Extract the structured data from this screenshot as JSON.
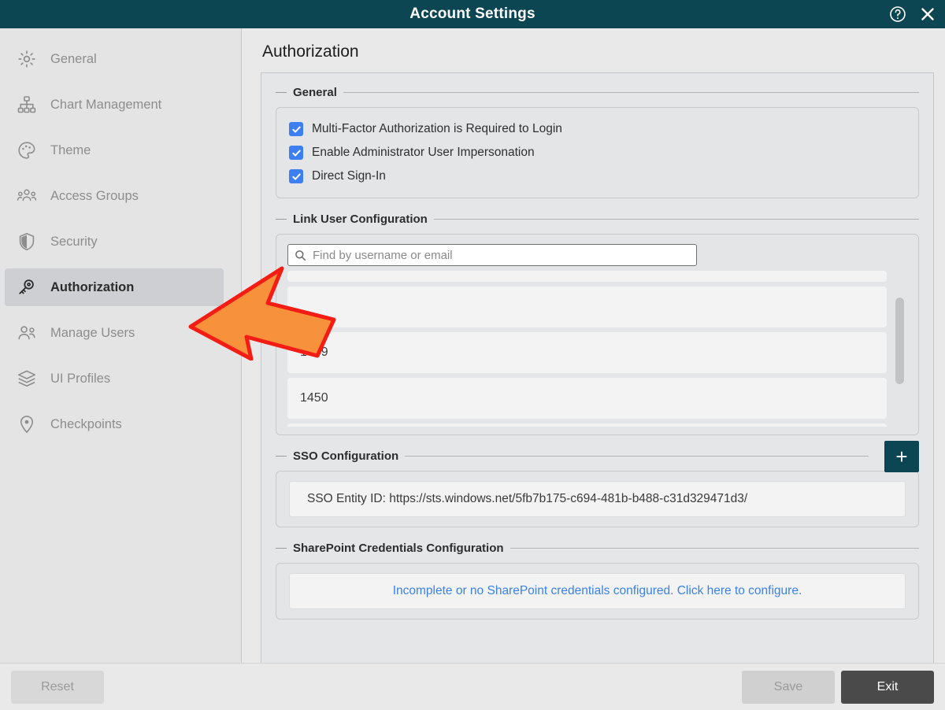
{
  "titlebar": {
    "title": "Account Settings",
    "help_icon": "help-circle-icon",
    "close_icon": "close-icon"
  },
  "sidebar": {
    "items": [
      {
        "label": "General",
        "icon": "gear-icon",
        "active": false
      },
      {
        "label": "Chart Management",
        "icon": "org-chart-icon",
        "active": false
      },
      {
        "label": "Theme",
        "icon": "palette-icon",
        "active": false
      },
      {
        "label": "Access Groups",
        "icon": "user-group-icon",
        "active": false
      },
      {
        "label": "Security",
        "icon": "shield-icon",
        "active": false
      },
      {
        "label": "Authorization",
        "icon": "key-icon",
        "active": true
      },
      {
        "label": "Manage Users",
        "icon": "users-icon",
        "active": false
      },
      {
        "label": "UI Profiles",
        "icon": "layers-icon",
        "active": false
      },
      {
        "label": "Checkpoints",
        "icon": "map-pin-icon",
        "active": false
      }
    ]
  },
  "main": {
    "page_title": "Authorization",
    "groups": {
      "general": {
        "title": "General",
        "checkboxes": [
          {
            "label": "Multi-Factor Authorization is Required to Login",
            "checked": true
          },
          {
            "label": "Enable Administrator User Impersonation",
            "checked": true
          },
          {
            "label": "Direct Sign-In",
            "checked": true
          }
        ]
      },
      "link_user": {
        "title": "Link User Configuration",
        "search_placeholder": "Find by username or email",
        "search_value": "",
        "search_icon": "search-icon",
        "rows": [
          "",
          "",
          "1059",
          "1450",
          ""
        ]
      },
      "sso": {
        "title": "SSO Configuration",
        "add_label": "+",
        "entity_id_text": "SSO Entity ID: https://sts.windows.net/5fb7b175-c694-481b-b488-c31d329471d3/"
      },
      "sharepoint": {
        "title": "SharePoint Credentials Configuration",
        "link_text": "Incomplete or no SharePoint credentials configured. Click here to configure."
      }
    }
  },
  "footer": {
    "reset_label": "Reset",
    "save_label": "Save",
    "exit_label": "Exit"
  },
  "annotation": {
    "arrow": "pointer-arrow",
    "fill": "#F7913C",
    "stroke": "#F41D15"
  },
  "colors": {
    "titlebar": "#0d4653",
    "accent": "#0d4653",
    "checkbox": "#3d7ff0",
    "link": "#3b82e8",
    "exit_button": "#4a4a4a"
  }
}
